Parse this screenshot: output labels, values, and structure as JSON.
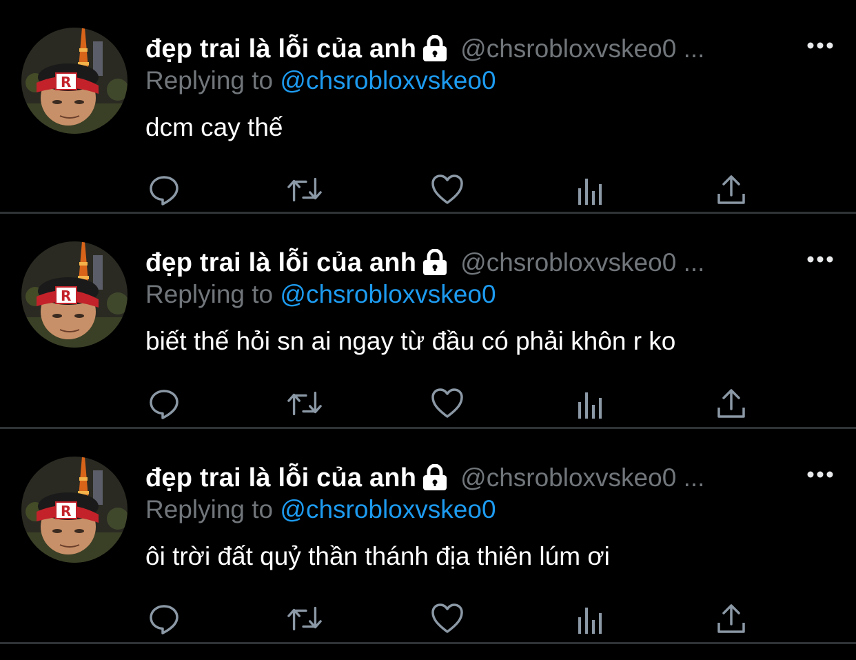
{
  "colors": {
    "background": "#000000",
    "divider": "#2f3336",
    "text_primary": "#ffffff",
    "text_secondary": "#71767b",
    "accent": "#1d9bf0"
  },
  "tweets": [
    {
      "display_name": "đẹp trai là lỗi của anh",
      "handle": "@chsrobloxvskeo0 ...",
      "replying_prefix": "Replying to ",
      "replying_to": "@chsrobloxvskeo0",
      "text": "dcm cay thế"
    },
    {
      "display_name": "đẹp trai là lỗi của anh",
      "handle": "@chsrobloxvskeo0 ...",
      "replying_prefix": "Replying to ",
      "replying_to": "@chsrobloxvskeo0",
      "text": "biết thế hỏi sn ai ngay từ đầu có phải khôn r ko"
    },
    {
      "display_name": "đẹp trai là lỗi của anh",
      "handle": "@chsrobloxvskeo0 ...",
      "replying_prefix": "Replying to ",
      "replying_to": "@chsrobloxvskeo0",
      "text": "ôi trời đất quỷ thần thánh địa thiên lúm ơi"
    }
  ],
  "icons": {
    "lock": "lock-icon",
    "more": "more-horizontal-icon",
    "reply": "reply-icon",
    "retweet": "retweet-icon",
    "like": "heart-icon",
    "views": "analytics-icon",
    "share": "share-icon"
  }
}
